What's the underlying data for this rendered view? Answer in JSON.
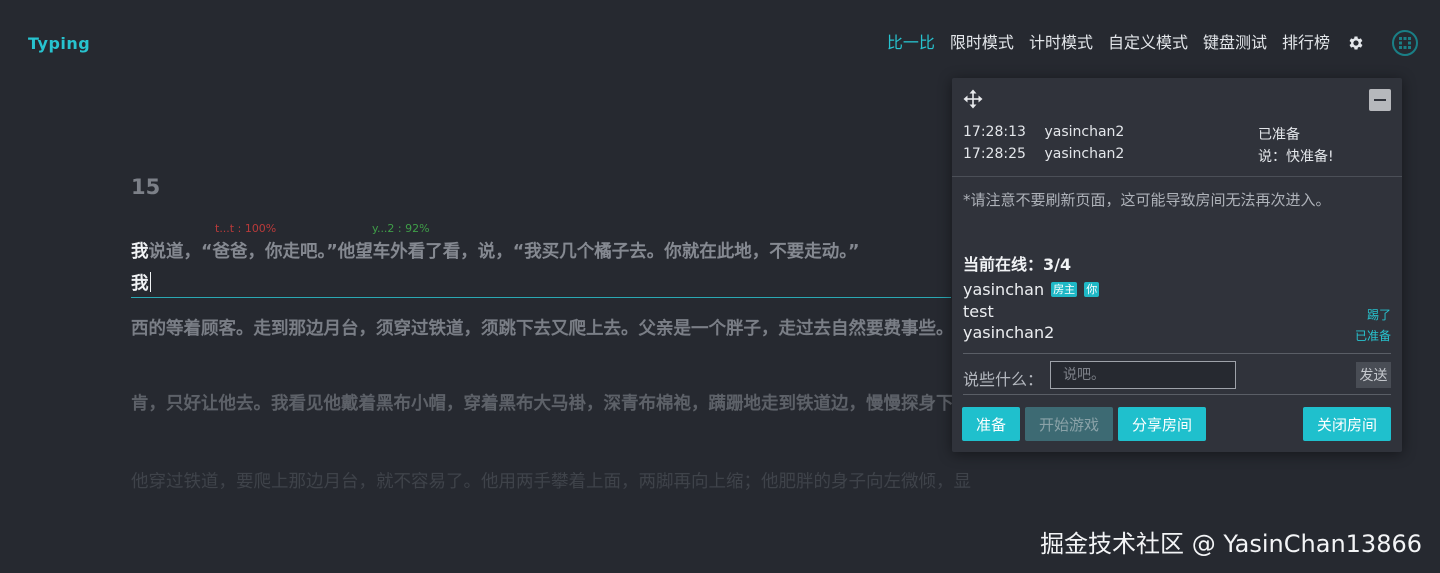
{
  "header": {
    "logo": "Typing",
    "nav": [
      "比一比",
      "限时模式",
      "计时模式",
      "自定义模式",
      "键盘测试",
      "排行榜"
    ],
    "active_nav_index": 0,
    "accent_color": "#27c3cf"
  },
  "typing": {
    "counter": "15",
    "stat_red": "t...t : 100%",
    "stat_green": "y...2 : 92%",
    "line1_typed": "我",
    "line1_rest": "说道，“爸爸，你走吧。”他望车外看了看，说，“我买几个橘子去。你就在此地，不要走动。”",
    "input_value": "我",
    "line2": "西的等着顾客。走到那边月台，须穿过铁道，须跳下去又爬上去。父亲是一个胖子，走过去自然要费事些。",
    "line3": "肯，只好让他去。我看见他戴着黑布小帽，穿着黑布大马褂，深青布棉袍，蹒跚地走到铁道边，慢慢探身下去，",
    "line4": "他穿过铁道，要爬上那边月台，就不容易了。他用两手攀着上面，两脚再向上缩；他肥胖的身子向左微倾，显出努力的样子。这"
  },
  "room": {
    "messages": [
      {
        "time": "17:28:13",
        "user": "yasinchan2",
        "text": "已准备"
      },
      {
        "time": "17:28:25",
        "user": "yasinchan2",
        "text": "说：快准备!"
      }
    ],
    "notice": "*请注意不要刷新页面，这可能导致房间无法再次进入。",
    "online_label": "当前在线：3/4",
    "players": [
      {
        "name": "yasinchan",
        "tags": [
          "房主",
          "你"
        ],
        "status": ""
      },
      {
        "name": "test",
        "tags": [],
        "status": "踢了"
      },
      {
        "name": "yasinchan2",
        "tags": [],
        "status": "已准备"
      }
    ],
    "say_label": "说些什么：",
    "say_placeholder": "说吧。",
    "send_label": "发送",
    "buttons": {
      "ready": "准备",
      "start": "开始游戏",
      "share": "分享房间",
      "close": "关闭房间"
    }
  },
  "watermark": "掘金技术社区 @ YasinChan13866"
}
